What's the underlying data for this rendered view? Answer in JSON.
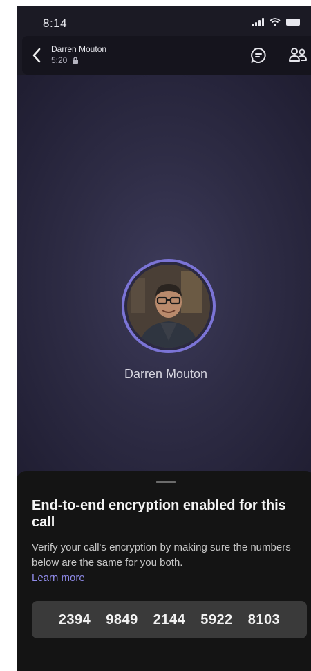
{
  "status_bar": {
    "time": "8:14",
    "icons": [
      "signal-icon",
      "wifi-icon",
      "battery-icon"
    ]
  },
  "call_header": {
    "caller_name": "Darren Mouton",
    "timer": "5:20",
    "timer_icon": "lock-icon",
    "actions": [
      "chat-icon",
      "people-icon"
    ]
  },
  "stage": {
    "caller_name": "Darren Mouton"
  },
  "encryption_sheet": {
    "title": "End-to-end encryption enabled for this call",
    "description": "Verify your call's encryption by making sure the numbers below are the same for you both.",
    "learn_more": "Learn more",
    "codes": [
      "2394",
      "9849",
      "2144",
      "5922",
      "8103"
    ]
  },
  "colors": {
    "accent": "#7b74d6",
    "link": "#8f8ae8",
    "sheet_bg": "#141414",
    "stage_bg": "#2e2c45"
  }
}
